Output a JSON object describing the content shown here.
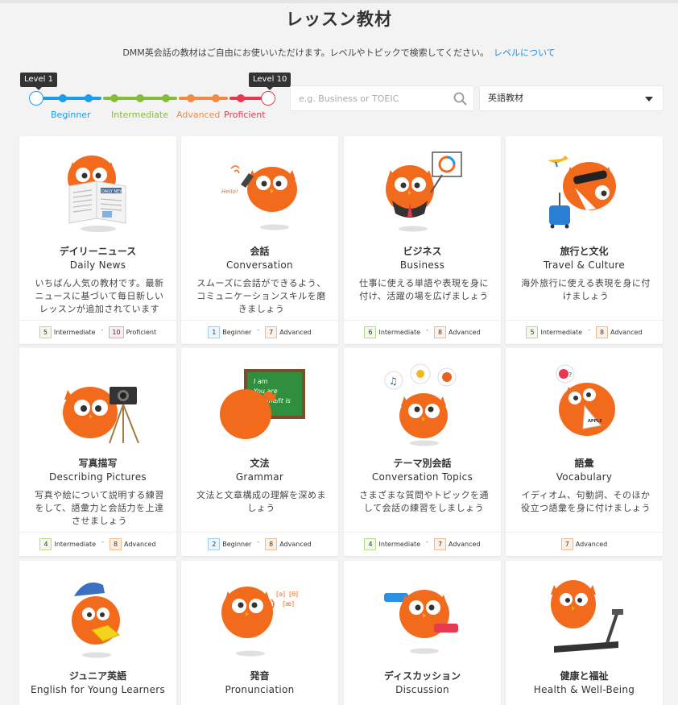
{
  "page": {
    "title": "レッスン教材",
    "intro_text": "DMM英会話の教材はご自由にお使いいただけます。レベルやトピックで検索してください。",
    "intro_link": "レベルについて"
  },
  "level_slider": {
    "min_tag": "Level 1",
    "max_tag": "Level 10",
    "labels": {
      "beginner": "Beginner",
      "intermediate": "Intermediate",
      "advanced": "Advanced",
      "proficient": "Proficient"
    },
    "colors": {
      "beginner": "#1a9cf0",
      "intermediate": "#86bc3b",
      "advanced": "#f08a45",
      "proficient": "#e8384f"
    }
  },
  "search": {
    "placeholder": "e.g. Business or TOEIC",
    "value": ""
  },
  "filter_select": {
    "selected": "英語教材"
  },
  "cards": [
    {
      "jp": "デイリーニュース",
      "en": "Daily News",
      "desc": "いちばん人気の教材です。最新ニュースに基づいて毎日新しいレッスンが追加されています",
      "min": {
        "num": "5",
        "label": "Intermediate",
        "tone": "green"
      },
      "max": {
        "num": "10",
        "label": "Proficient",
        "tone": "red"
      },
      "icon": "owl-newspaper-icon",
      "paper_text": "DAILY NEWS"
    },
    {
      "jp": "会話",
      "en": "Conversation",
      "desc": "スムーズに会話ができるよう、コミュニケーションスキルを磨きましょう",
      "min": {
        "num": "1",
        "label": "Beginner",
        "tone": "blue"
      },
      "max": {
        "num": "7",
        "label": "Advanced",
        "tone": "orange"
      },
      "icon": "owl-phone-icon",
      "bubble_text": "Hello!"
    },
    {
      "jp": "ビジネス",
      "en": "Business",
      "desc": "仕事に使える単語や表現を身に付け、活躍の場を広げましょう",
      "min": {
        "num": "6",
        "label": "Intermediate",
        "tone": "green"
      },
      "max": {
        "num": "8",
        "label": "Advanced",
        "tone": "orange"
      },
      "icon": "owl-presentation-icon"
    },
    {
      "jp": "旅行と文化",
      "en": "Travel & Culture",
      "desc": "海外旅行に使える表現を身に付けましょう",
      "min": {
        "num": "5",
        "label": "Intermediate",
        "tone": "green"
      },
      "max": {
        "num": "8",
        "label": "Advanced",
        "tone": "orange"
      },
      "icon": "owl-travel-icon"
    },
    {
      "jp": "写真描写",
      "en": "Describing Pictures",
      "desc": "写真や絵について説明する練習をして、語彙力と会話力を上達させましょう",
      "min": {
        "num": "4",
        "label": "Intermediate",
        "tone": "green"
      },
      "max": {
        "num": "8",
        "label": "Advanced",
        "tone": "orange"
      },
      "icon": "owl-camera-icon"
    },
    {
      "jp": "文法",
      "en": "Grammar",
      "desc": "文法と文章構成の理解を深めましょう",
      "min": {
        "num": "2",
        "label": "Beginner",
        "tone": "blue"
      },
      "max": {
        "num": "8",
        "label": "Advanced",
        "tone": "orange"
      },
      "icon": "owl-blackboard-icon",
      "board_text": [
        "I am",
        "You are",
        "He/She/It is"
      ]
    },
    {
      "jp": "テーマ別会話",
      "en": "Conversation Topics",
      "desc": "さまざまな質問やトピックを通して会話の練習をしましょう",
      "min": {
        "num": "4",
        "label": "Intermediate",
        "tone": "green"
      },
      "max": {
        "num": "7",
        "label": "Advanced",
        "tone": "orange"
      },
      "icon": "owl-thinking-icon"
    },
    {
      "jp": "語彙",
      "en": "Vocabulary",
      "desc": "イディオム、句動詞、そのほか役立つ語彙を身に付けましょう",
      "min": null,
      "max": {
        "num": "7",
        "label": "Advanced",
        "tone": "orange"
      },
      "icon": "owl-apple-card-icon",
      "card_text": "APPLE"
    },
    {
      "jp": "ジュニア英語",
      "en": "English for Young Learners",
      "desc": "",
      "min": null,
      "max": null,
      "icon": "owl-cap-book-icon"
    },
    {
      "jp": "発音",
      "en": "Pronunciation",
      "desc": "",
      "min": null,
      "max": null,
      "icon": "owl-speaking-icon",
      "phonetics": [
        "[ə]",
        "[θ]",
        "[æ]"
      ]
    },
    {
      "jp": "ディスカッション",
      "en": "Discussion",
      "desc": "",
      "min": null,
      "max": null,
      "icon": "owl-discussion-icon"
    },
    {
      "jp": "健康と福祉",
      "en": "Health & Well-Being",
      "desc": "",
      "min": null,
      "max": null,
      "icon": "owl-treadmill-icon"
    }
  ]
}
